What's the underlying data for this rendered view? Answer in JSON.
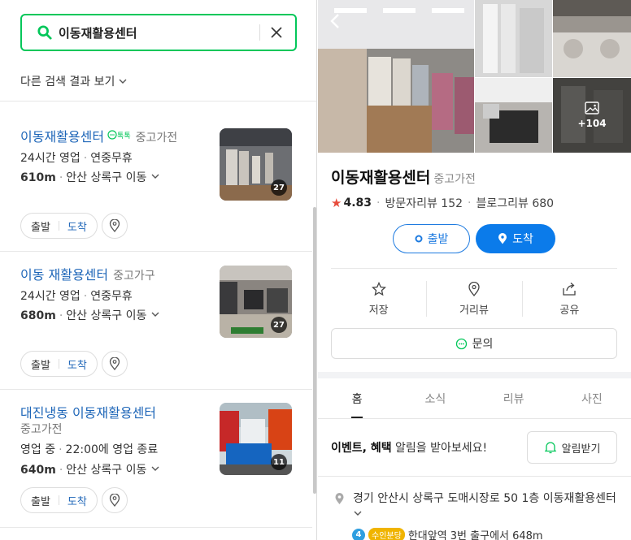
{
  "search": {
    "query": "이동재활용센터",
    "other_results": "다른 검색 결과 보기"
  },
  "results": [
    {
      "name": "이동재활용센터",
      "talk": "톡톡",
      "category": "중고가전",
      "hours": "24시간 영업",
      "holiday": "연중무휴",
      "distance": "610m",
      "area": "안산 상록구 이동",
      "photo_count": "27",
      "start": "출발",
      "arrive": "도착"
    },
    {
      "name": "이동 재활용센터",
      "category": "중고가구",
      "hours": "24시간 영업",
      "holiday": "연중무휴",
      "distance": "680m",
      "area": "안산 상록구 이동",
      "photo_count": "27",
      "start": "출발",
      "arrive": "도착"
    },
    {
      "name": "대진냉동 이동재활용센터",
      "category": "중고가전",
      "status": "영업 중",
      "closing": "22:00에 영업 종료",
      "distance": "640m",
      "area": "안산 상록구 이동",
      "photo_count": "11",
      "start": "출발",
      "arrive": "도착"
    }
  ],
  "detail": {
    "name": "이동재활용센터",
    "category": "중고가전",
    "rating": "4.83",
    "visitor_reviews": "방문자리뷰 152",
    "blog_reviews": "블로그리뷰 680",
    "more_photos": "+104",
    "start": "출발",
    "arrive": "도착",
    "actions": [
      "저장",
      "거리뷰",
      "공유"
    ],
    "inquiry": "문의",
    "tabs": [
      "홈",
      "소식",
      "리뷰",
      "사진"
    ],
    "event_bold": "이벤트, 혜택",
    "event_rest": " 알림을 받아보세요!",
    "notify": "알림받기",
    "address": "경기 안산시 상록구 도매시장로 50 1층 이동재활용센터",
    "subway_line": "4",
    "subway_tag": "수인분당",
    "subway_text": "한대앞역 3번 출구에서 648m"
  },
  "colors": {
    "green": "#03c75a",
    "link_blue": "#1e66b8",
    "primary_blue": "#0b7bea",
    "star_red": "#e74c3c"
  }
}
